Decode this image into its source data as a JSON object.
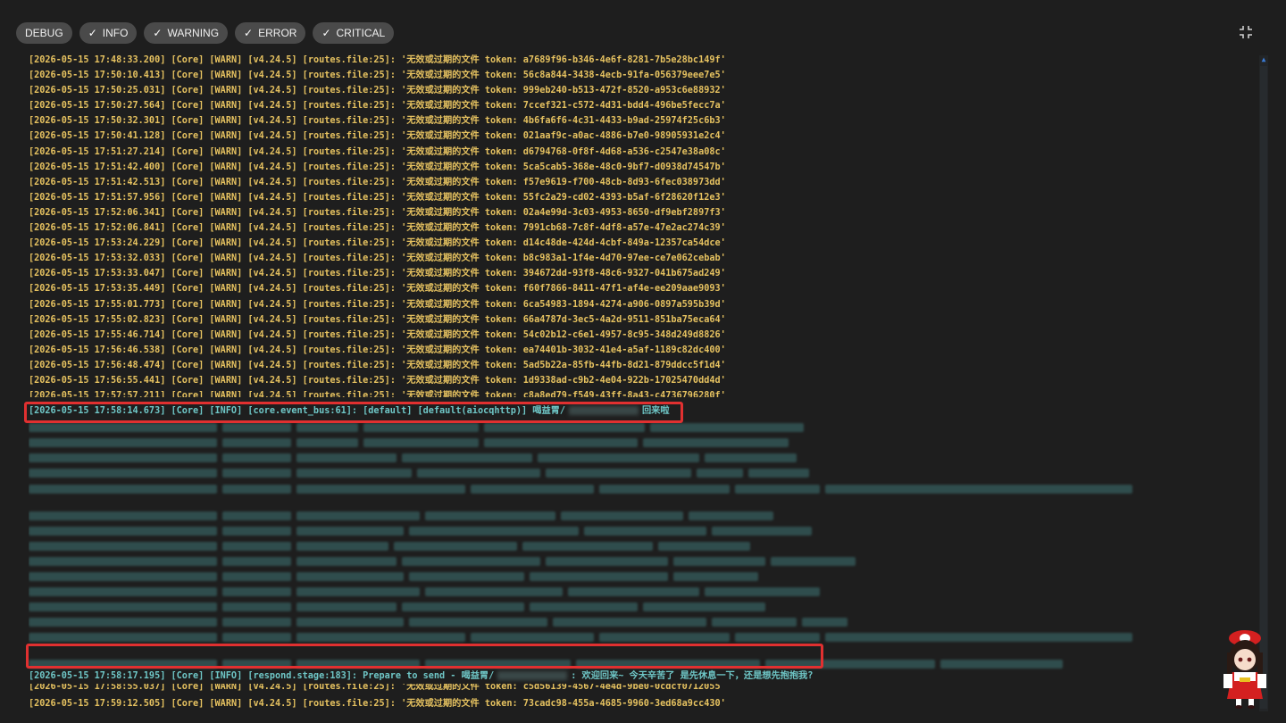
{
  "filters": [
    {
      "label": "DEBUG",
      "checked": false
    },
    {
      "label": "INFO",
      "checked": true
    },
    {
      "label": "WARNING",
      "checked": true
    },
    {
      "label": "ERROR",
      "checked": true
    },
    {
      "label": "CRITICAL",
      "checked": true
    }
  ],
  "fullscreen_icon": "collapse-icon",
  "warn_prefix": "[Core] [WARN] [v4.24.5] [routes.file:25]: '无效或过期的文件 token: ",
  "logs_top": [
    {
      "ts": "[2026-05-15 17:48:33.200]",
      "token": "a7689f96-b346-4e6f-8281-7b5e28bc149f"
    },
    {
      "ts": "[2026-05-15 17:50:10.413]",
      "token": "56c8a844-3438-4ecb-91fa-056379eee7e5"
    },
    {
      "ts": "[2026-05-15 17:50:25.031]",
      "token": "999eb240-b513-472f-8520-a953c6e88932"
    },
    {
      "ts": "[2026-05-15 17:50:27.564]",
      "token": "7ccef321-c572-4d31-bdd4-496be5fecc7a"
    },
    {
      "ts": "[2026-05-15 17:50:32.301]",
      "token": "4b6fa6f6-4c31-4433-b9ad-25974f25c6b3"
    },
    {
      "ts": "[2026-05-15 17:50:41.128]",
      "token": "021aaf9c-a0ac-4886-b7e0-98905931e2c4"
    },
    {
      "ts": "[2026-05-15 17:51:27.214]",
      "token": "d6794768-0f8f-4d68-a536-c2547e38a08c"
    },
    {
      "ts": "[2026-05-15 17:51:42.400]",
      "token": "5ca5cab5-368e-48c0-9bf7-d0938d74547b"
    },
    {
      "ts": "[2026-05-15 17:51:42.513]",
      "token": "f57e9619-f700-48cb-8d93-6fec038973dd"
    },
    {
      "ts": "[2026-05-15 17:51:57.956]",
      "token": "55fc2a29-cd02-4393-b5af-6f28620f12e3"
    },
    {
      "ts": "[2026-05-15 17:52:06.341]",
      "token": "02a4e99d-3c03-4953-8650-df9ebf2897f3"
    },
    {
      "ts": "[2026-05-15 17:52:06.841]",
      "token": "7991cb68-7c8f-4df8-a57e-47e2ac274c39"
    },
    {
      "ts": "[2026-05-15 17:53:24.229]",
      "token": "d14c48de-424d-4cbf-849a-12357ca54dce"
    },
    {
      "ts": "[2026-05-15 17:53:32.033]",
      "token": "b8c983a1-1f4e-4d70-97ee-ce7e062cebab"
    },
    {
      "ts": "[2026-05-15 17:53:33.047]",
      "token": "394672dd-93f8-48c6-9327-041b675ad249"
    },
    {
      "ts": "[2026-05-15 17:53:35.449]",
      "token": "f60f7866-8411-47f1-af4e-ee209aae9093"
    },
    {
      "ts": "[2026-05-15 17:55:01.773]",
      "token": "6ca54983-1894-4274-a906-0897a595b39d"
    },
    {
      "ts": "[2026-05-15 17:55:02.823]",
      "token": "66a4787d-3ec5-4a2d-9511-851ba75eca64"
    },
    {
      "ts": "[2026-05-15 17:55:46.714]",
      "token": "54c02b12-c6e1-4957-8c95-348d249d8826"
    },
    {
      "ts": "[2026-05-15 17:56:46.538]",
      "token": "ea74401b-3032-41e4-a5af-1189c82dc400"
    },
    {
      "ts": "[2026-05-15 17:56:48.474]",
      "token": "5ad5b22a-85fb-44fb-8d21-879ddcc5f1d4"
    },
    {
      "ts": "[2026-05-15 17:56:55.441]",
      "token": "1d9338ad-c9b2-4e04-922b-17025470dd4d"
    },
    {
      "ts": "[2026-05-15 17:57:57.211]",
      "token": "c8a8ed79-f549-43ff-8a43-c4736796280f"
    }
  ],
  "highlight1": {
    "prefix": "[2026-05-15 17:58:14.673] [Core] [INFO] [core.event_bus:61]: [default] [default(aiocqhttp)] 喝益胃/",
    "suffix": "回来啦"
  },
  "highlight2": {
    "prefix": "[2026-05-15 17:58:17.195] [Core] [INFO] [respond.stage:183]: Prepare to send - 喝益胃/",
    "suffix": ": 欢迎回来~ 今天辛苦了 是先休息一下，还是想先抱抱我?"
  },
  "log_partial": "[2026-05-15 17:58:55.037] [Core] [WARN] [v4.24.5] [routes.file:25]: '无效或过期的文件 token: c5d56139-4567-4e4d-9be0-0cdcf0712055",
  "log_last": {
    "ts": "[2026-05-15 17:59:12.505]",
    "token": "73cadc98-455a-4685-9960-3ed68a9cc430'"
  },
  "colors": {
    "warn": "#e6c260",
    "info": "#6fc7c7",
    "highlight": "#e03030",
    "background": "#1e1e1e"
  }
}
